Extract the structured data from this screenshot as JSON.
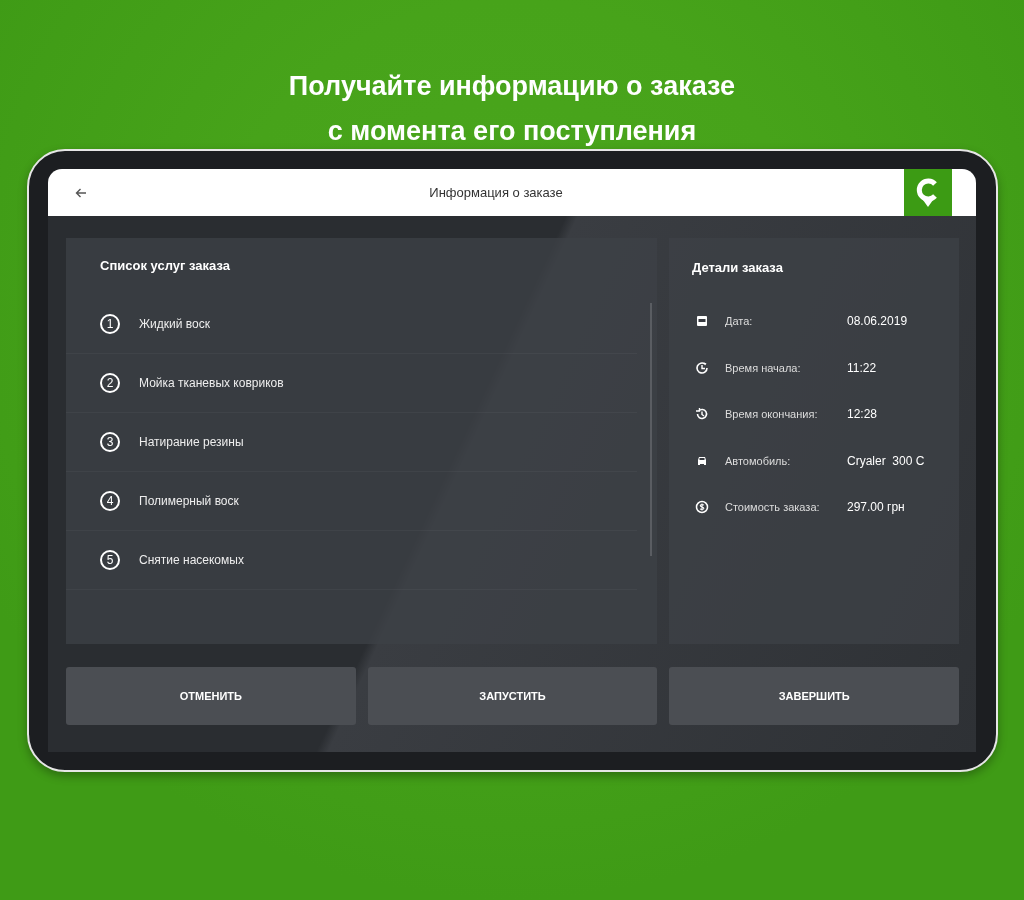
{
  "headline": [
    "Получайте информацию о заказе",
    "с момента его поступления"
  ],
  "app_bar": {
    "title": "Информация о заказе"
  },
  "services": {
    "title": "Список услуг заказа",
    "items": [
      {
        "number": "1",
        "name": "Жидкий воск"
      },
      {
        "number": "2",
        "name": "Мойка тканевых ковриков"
      },
      {
        "number": "3",
        "name": "Натирание резины"
      },
      {
        "number": "4",
        "name": "Полимерный воск"
      },
      {
        "number": "5",
        "name": "Снятие насекомых"
      }
    ]
  },
  "details": {
    "title": "Детали заказа",
    "rows": [
      {
        "kind": "date",
        "label": "Дата:",
        "value": "08.06.2019"
      },
      {
        "kind": "start",
        "label": "Время начала:",
        "value": "11:22"
      },
      {
        "kind": "end",
        "label": "Время окончания:",
        "value": "12:28"
      },
      {
        "kind": "car",
        "label": "Автомобиль:",
        "value": "Cryaler  300 C"
      },
      {
        "kind": "cost",
        "label": "Стоимость заказа:",
        "value": "297.00 грн"
      }
    ]
  },
  "buttons": [
    "ОТМЕНИТЬ",
    "ЗАПУСТИТЬ",
    "ЗАВЕРШИТЬ"
  ]
}
